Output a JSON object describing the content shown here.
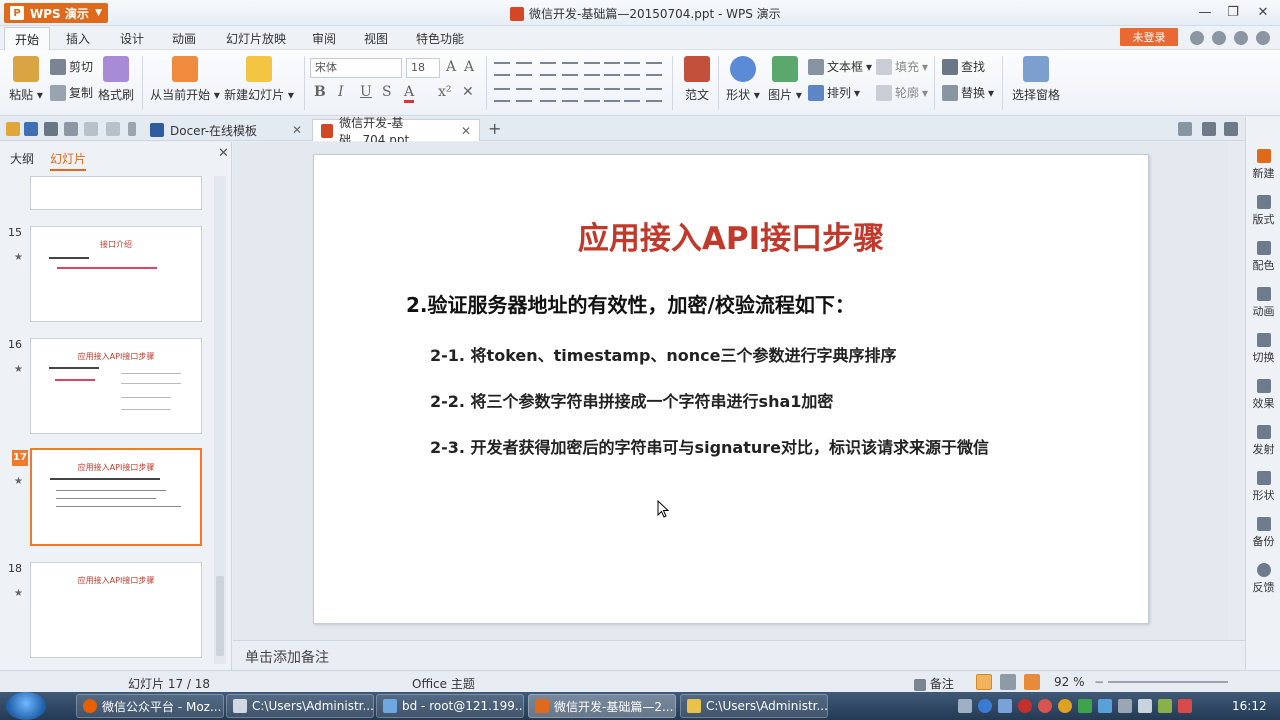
{
  "app": {
    "name": "WPS 演示",
    "window_title": "微信开发-基础篇—20150704.ppt - WPS 演示"
  },
  "ribbon_tabs": [
    "开始",
    "插入",
    "设计",
    "动画",
    "幻灯片放映",
    "审阅",
    "视图",
    "特色功能"
  ],
  "login_label": "未登录",
  "ribbon": {
    "paste": "粘贴",
    "cut": "剪切",
    "copy": "复制",
    "format_painter": "格式刷",
    "from_current": "从当前开始",
    "new_slide": "新建幻灯片",
    "font_name": "宋体",
    "font_size": "18",
    "sample_template": "范文",
    "shape": "形状",
    "picture": "图片",
    "textbox": "文本框",
    "fill": "填充",
    "outline": "轮廓",
    "arrange": "排列",
    "find": "查找",
    "replace": "替换",
    "selection_pane": "选择窗格"
  },
  "doc_tabs": [
    {
      "label": "Docer-在线模板"
    },
    {
      "label": "微信开发-基础...704.ppt"
    }
  ],
  "left_panel": {
    "tabs": [
      "大纲",
      "幻灯片"
    ],
    "thumbnails": [
      {
        "num": "15",
        "title": "接口介绍"
      },
      {
        "num": "16",
        "title": "应用接入API接口步骤"
      },
      {
        "num": "17",
        "title": "应用接入API接口步骤"
      },
      {
        "num": "18",
        "title": "应用接入API接口步骤"
      }
    ]
  },
  "slide": {
    "title": "应用接入API接口步骤",
    "heading": "2.验证服务器地址的有效性，加密/校验流程如下：",
    "items": [
      "2-1. 将token、timestamp、nonce三个参数进行字典序排序",
      "2-2. 将三个参数字符串拼接成一个字符串进行sha1加密",
      "2-3. 开发者获得加密后的字符串可与signature对比，标识该请求来源于微信"
    ]
  },
  "notes_placeholder": "单击添加备注",
  "right_panel": [
    "新建",
    "版式",
    "配色",
    "动画",
    "切换",
    "效果",
    "发射",
    "形状",
    "备份",
    "反馈"
  ],
  "status": {
    "slide_counter": "幻灯片 17 / 18",
    "theme": "Office 主题",
    "notes": "备注",
    "zoom": "92 %"
  },
  "taskbar": {
    "tasks": [
      "微信公众平台 - Moz...",
      "C:\\Users\\Administr...",
      "bd - root@121.199...",
      "微信开发-基础篇—2...",
      "C:\\Users\\Administr..."
    ],
    "clock": "16:12"
  },
  "colors": {
    "accent": "#e06a1b",
    "slide_title": "#c0392b"
  }
}
